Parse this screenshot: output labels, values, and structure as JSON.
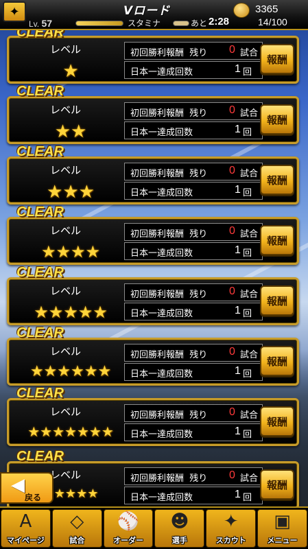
{
  "header": {
    "title": "Vロード",
    "coins": "3365",
    "level_prefix": "Lv.",
    "level": "57",
    "stamina_label": "スタミナ",
    "ato_label": "あと",
    "timer": "2:28",
    "stamina": "14/100"
  },
  "cards": [
    {
      "clear": "CLEAR",
      "level_label": "レベル",
      "stars": "★",
      "first_win": "初回勝利報酬",
      "remaining": "残り",
      "remaining_count": "0",
      "remaining_unit": "試合",
      "champion": "日本一達成回数",
      "champion_count": "1",
      "champion_unit": "回",
      "reward": "報酬"
    },
    {
      "clear": "CLEAR",
      "level_label": "レベル",
      "stars": "★★",
      "first_win": "初回勝利報酬",
      "remaining": "残り",
      "remaining_count": "0",
      "remaining_unit": "試合",
      "champion": "日本一達成回数",
      "champion_count": "1",
      "champion_unit": "回",
      "reward": "報酬"
    },
    {
      "clear": "CLEAR",
      "level_label": "レベル",
      "stars": "★★★",
      "first_win": "初回勝利報酬",
      "remaining": "残り",
      "remaining_count": "0",
      "remaining_unit": "試合",
      "champion": "日本一達成回数",
      "champion_count": "1",
      "champion_unit": "回",
      "reward": "報酬"
    },
    {
      "clear": "CLEAR",
      "level_label": "レベル",
      "stars": "★★★★",
      "first_win": "初回勝利報酬",
      "remaining": "残り",
      "remaining_count": "0",
      "remaining_unit": "試合",
      "champion": "日本一達成回数",
      "champion_count": "1",
      "champion_unit": "回",
      "reward": "報酬"
    },
    {
      "clear": "CLEAR",
      "level_label": "レベル",
      "stars": "★★★★★",
      "first_win": "初回勝利報酬",
      "remaining": "残り",
      "remaining_count": "0",
      "remaining_unit": "試合",
      "champion": "日本一達成回数",
      "champion_count": "1",
      "champion_unit": "回",
      "reward": "報酬"
    },
    {
      "clear": "CLEAR",
      "level_label": "レベル",
      "stars": "★★★★★★",
      "first_win": "初回勝利報酬",
      "remaining": "残り",
      "remaining_count": "0",
      "remaining_unit": "試合",
      "champion": "日本一達成回数",
      "champion_count": "1",
      "champion_unit": "回",
      "reward": "報酬"
    },
    {
      "clear": "CLEAR",
      "level_label": "レベル",
      "stars": "★★★★★★★",
      "first_win": "初回勝利報酬",
      "remaining": "残り",
      "remaining_count": "0",
      "remaining_unit": "試合",
      "champion": "日本一達成回数",
      "champion_count": "1",
      "champion_unit": "回",
      "reward": "報酬"
    },
    {
      "clear": "CLEAR",
      "level_label": "レベル",
      "stars": "★★★★★",
      "first_win": "初回勝利報酬",
      "remaining": "残り",
      "remaining_count": "0",
      "remaining_unit": "試合",
      "champion": "日本一達成回数",
      "champion_count": "1",
      "champion_unit": "回",
      "reward": "報酬"
    }
  ],
  "back_button": {
    "label": "戻る"
  },
  "nav": [
    {
      "label": "マイページ",
      "icon": "A"
    },
    {
      "label": "試合",
      "icon": "◇"
    },
    {
      "label": "オーダー",
      "icon": "⚾"
    },
    {
      "label": "選手",
      "icon": "☻"
    },
    {
      "label": "スカウト",
      "icon": "✦"
    },
    {
      "label": "メニュー",
      "icon": "▣"
    }
  ]
}
